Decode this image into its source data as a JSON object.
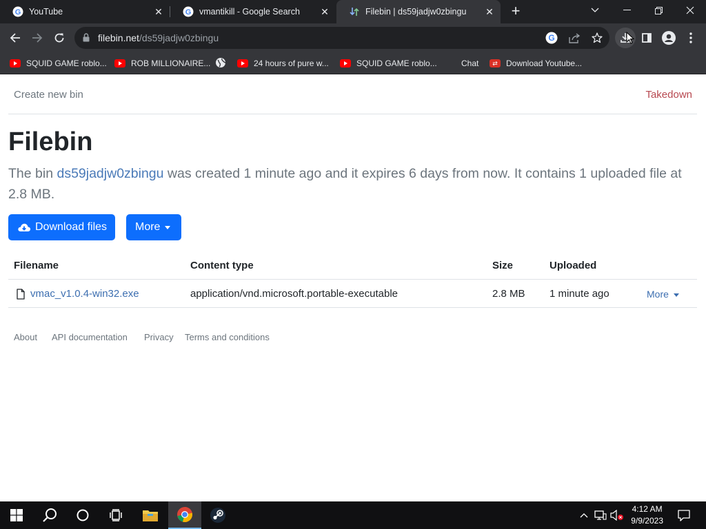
{
  "browser": {
    "tabs": [
      {
        "title": "YouTube"
      },
      {
        "title": "vmantikill - Google Search"
      },
      {
        "title": "Filebin | ds59jadjw0zbingu"
      }
    ],
    "address": {
      "host": "filebin.net",
      "path": "/ds59jadjw0zbingu"
    },
    "bookmarks": [
      {
        "label": "SQUID GAME roblo..."
      },
      {
        "label": "ROB MILLIONAIRE..."
      },
      {
        "label": "24 hours of pure w..."
      },
      {
        "label": "SQUID GAME roblo..."
      },
      {
        "label": "Chat"
      },
      {
        "label": "Download Youtube..."
      }
    ]
  },
  "page": {
    "nav": {
      "create": "Create new bin",
      "takedown": "Takedown"
    },
    "heading": "Filebin",
    "lead": {
      "prefix": "The bin ",
      "bin_id": "ds59jadjw0zbingu",
      "suffix": " was created 1 minute ago and it expires 6 days from now. It contains 1 uploaded file at 2.8 MB."
    },
    "buttons": {
      "download": "Download files",
      "more": "More"
    },
    "table": {
      "headers": [
        "Filename",
        "Content type",
        "Size",
        "Uploaded"
      ],
      "rows": [
        {
          "filename": "vmac_v1.0.4-win32.exe",
          "content_type": "application/vnd.microsoft.portable-executable",
          "size": "2.8 MB",
          "uploaded": "1 minute ago",
          "action": "More"
        }
      ]
    },
    "footer": [
      "About",
      "API documentation",
      "Privacy",
      "Terms and conditions"
    ]
  },
  "taskbar": {
    "time": "4:12 AM",
    "date": "9/9/2023"
  },
  "colors": {
    "primary": "#0d6efd",
    "takedown": "#b7474f",
    "link": "#3c6eb0",
    "chrome_dark": "#202124",
    "chrome_toolbar": "#35363a"
  }
}
